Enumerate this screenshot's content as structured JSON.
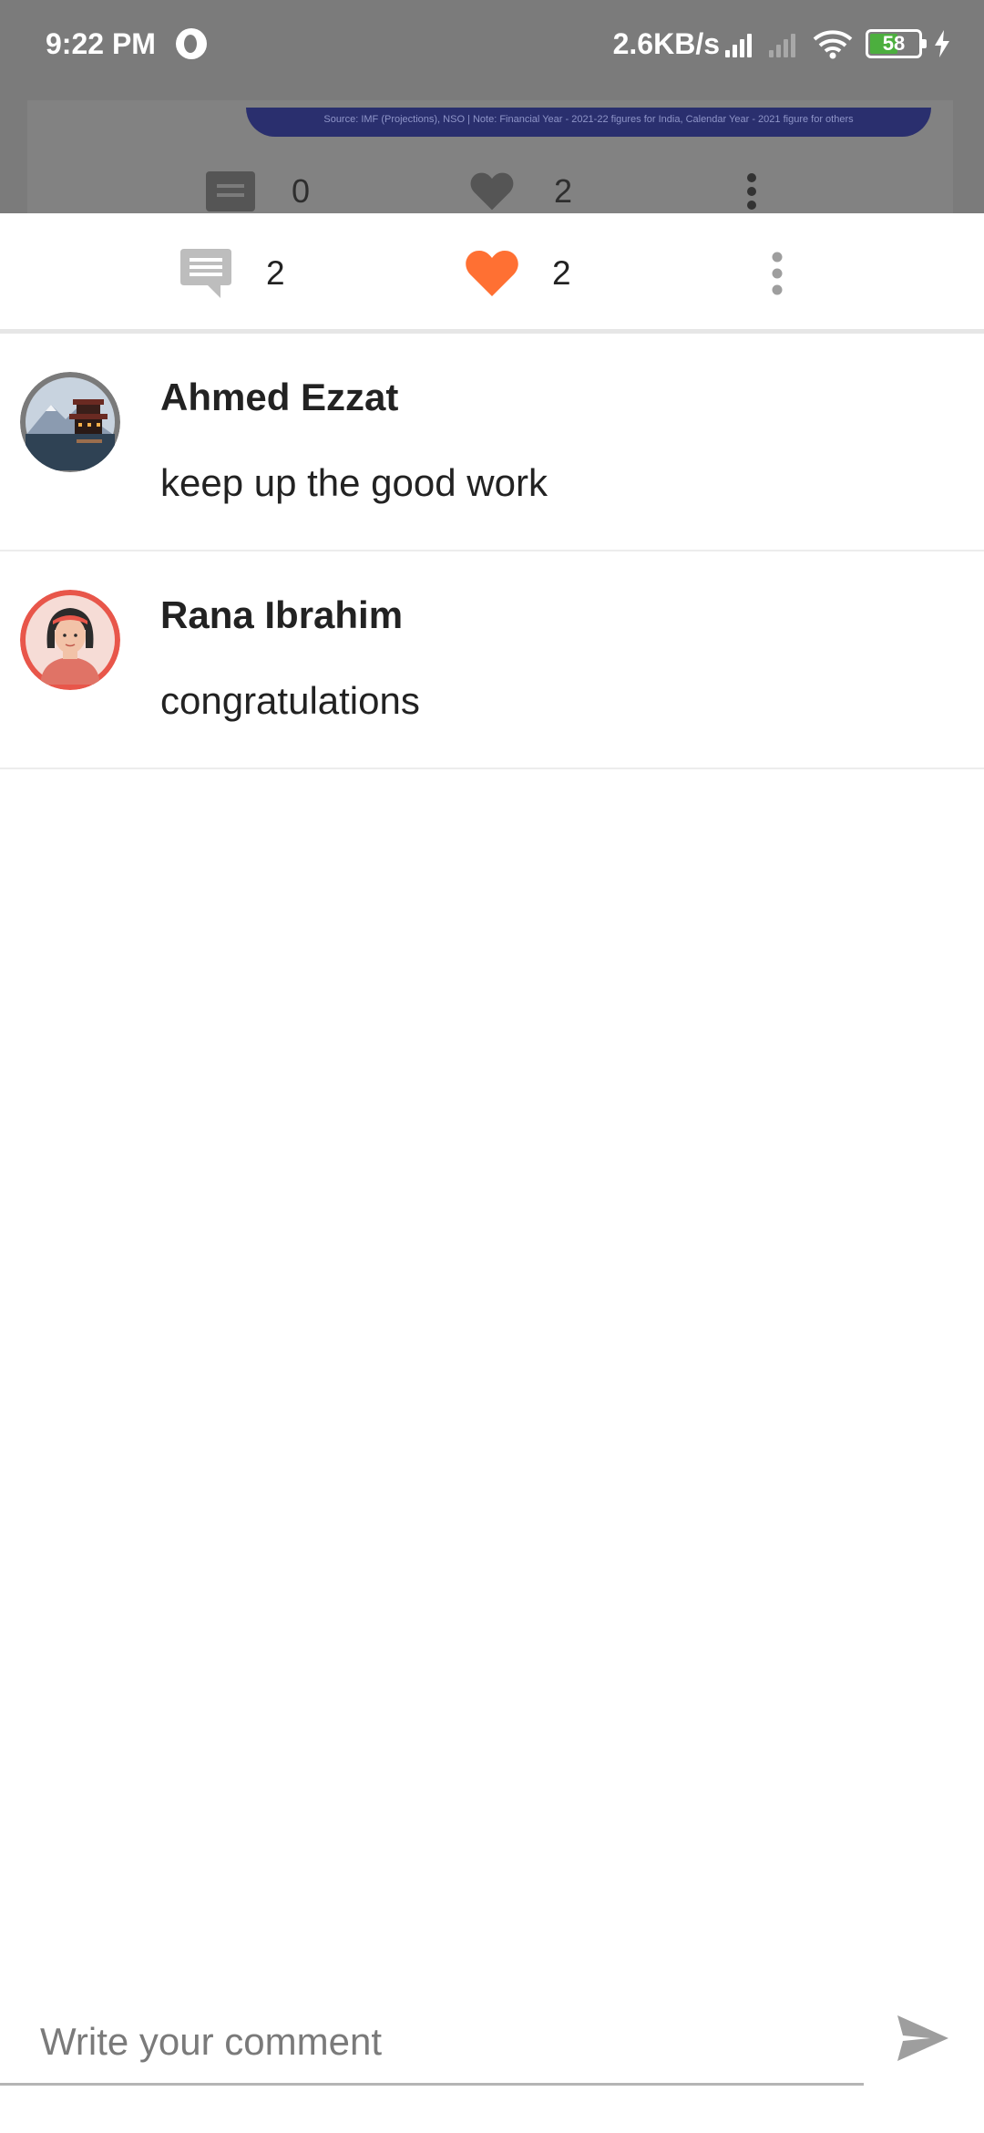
{
  "status_bar": {
    "time": "9:22 PM",
    "network_speed": "2.6KB/s",
    "battery_level": "58",
    "battery_fraction": 0.58,
    "icons": [
      "app-notification-icon",
      "signal-strong-icon",
      "signal-no-service-icon",
      "wifi-icon",
      "battery-icon",
      "charging-icon"
    ]
  },
  "background_post": {
    "banner_text": "Source: IMF (Projections), NSO | Note: Financial Year - 2021-22 figures for India, Calendar Year - 2021 figure for others",
    "comment_count": "0",
    "like_count": "2"
  },
  "actions": {
    "comment_count": "2",
    "like_count": "2",
    "like_color": "#ff7033"
  },
  "comments": [
    {
      "author": "Ahmed Ezzat",
      "text": "keep up the good work",
      "avatar": "landscape-photo"
    },
    {
      "author": "Rana Ibrahim",
      "text": "congratulations",
      "avatar": "female-avatar"
    }
  ],
  "compose": {
    "placeholder": "Write your comment",
    "value": ""
  },
  "colors": {
    "accent": "#ff7033",
    "icon_gray": "#bdbdbd",
    "divider": "#e6e6e6",
    "overlay": "#7b7b7b"
  }
}
